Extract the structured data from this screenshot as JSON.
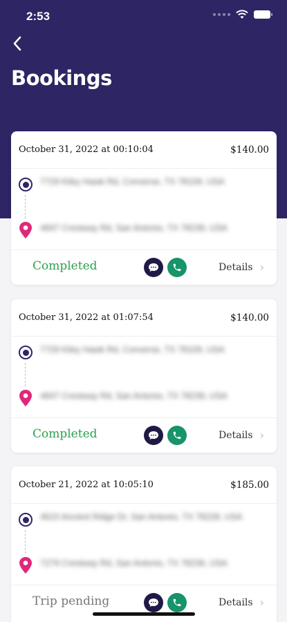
{
  "status_bar": {
    "time": "2:53"
  },
  "header": {
    "title": "Bookings"
  },
  "bookings": [
    {
      "date": "October 31, 2022 at 00:10:04",
      "price": "$140.00",
      "pickup": "7729 Kiley Hawk Rd, Converse, TX 78109, USA",
      "dropoff": "4847 Crestway Rd, San Antonio, TX 78239, USA",
      "status": "Completed",
      "details_label": "Details"
    },
    {
      "date": "October 31, 2022 at 01:07:54",
      "price": "$140.00",
      "pickup": "7729 Kiley Hawk Rd, Converse, TX 78109, USA",
      "dropoff": "4847 Crestway Rd, San Antonio, TX 78239, USA",
      "status": "Completed",
      "details_label": "Details"
    },
    {
      "date": "October 21, 2022 at 10:05:10",
      "price": "$185.00",
      "pickup": "4615 Ancient Ridge Dr, San Antonio, TX 78228, USA",
      "dropoff": "7279 Crestway Rd, San Antonio, TX 78239, USA",
      "status": "Trip pending",
      "details_label": "Details"
    }
  ],
  "colors": {
    "header_bg": "#2e2565",
    "completed": "#2aa24a",
    "pending": "#777777",
    "call": "#17946a",
    "chat": "#1f1a45",
    "drop_pin": "#e0287a"
  }
}
